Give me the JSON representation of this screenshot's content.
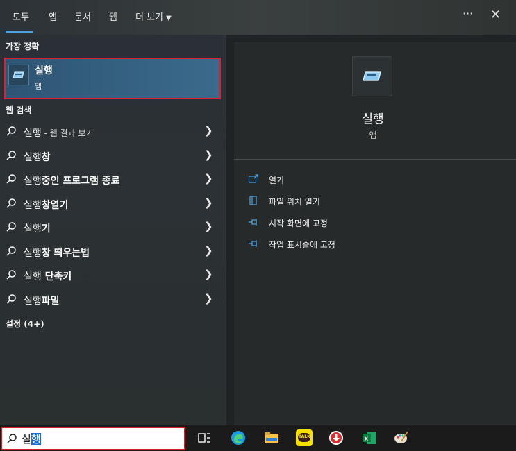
{
  "tabs": [
    {
      "label": "모두"
    },
    {
      "label": "앱"
    },
    {
      "label": "문서"
    },
    {
      "label": "웹"
    },
    {
      "label": "더 보기"
    }
  ],
  "more_icon": "ellipsis-icon",
  "close_icon": "close-icon",
  "best_match": {
    "heading": "가장 정확",
    "title": "실행",
    "subtitle": "앱"
  },
  "web": {
    "heading": "웹 검색",
    "items": [
      {
        "query": "실행",
        "suffix": "",
        "note": " - 웹 결과 보기"
      },
      {
        "query": "실행",
        "suffix": "창",
        "note": ""
      },
      {
        "query": "실행",
        "suffix": "중인 프로그램 종료",
        "note": ""
      },
      {
        "query": "실행",
        "suffix": "창열기",
        "note": ""
      },
      {
        "query": "실행",
        "suffix": "기",
        "note": ""
      },
      {
        "query": "실행",
        "suffix": "창 띄우는법",
        "note": ""
      },
      {
        "query": "실행",
        "suffix": " 단축키",
        "note": ""
      },
      {
        "query": "실행",
        "suffix": "파일",
        "note": ""
      }
    ]
  },
  "settings": {
    "heading": "설정 (4+)"
  },
  "detail": {
    "title": "실행",
    "subtitle": "앱",
    "actions": [
      {
        "label": "열기",
        "icon": "open-icon"
      },
      {
        "label": "파일 위치 열기",
        "icon": "file-location-icon"
      },
      {
        "label": "시작 화면에 고정",
        "icon": "pin-icon"
      },
      {
        "label": "작업 표시줄에 고정",
        "icon": "pin-icon"
      }
    ]
  },
  "search": {
    "typed": "실",
    "selected": "행"
  },
  "taskbar": {
    "apps": [
      "task-view-icon",
      "edge-icon",
      "file-explorer-icon",
      "kakaotalk-icon",
      "download-icon",
      "excel-icon",
      "paint-icon"
    ],
    "kakao_text": "TALK"
  },
  "colors": {
    "accent": "#4fa3e0",
    "highlight_border": "#e0202a"
  }
}
